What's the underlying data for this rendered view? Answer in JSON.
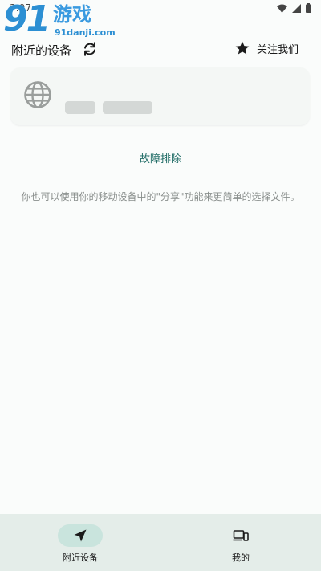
{
  "status_bar": {
    "time": "3:07"
  },
  "watermark": {
    "number": "91",
    "name": "游戏",
    "url": "91danji.com"
  },
  "header": {
    "title": "附近的设备",
    "follow_label": "关注我们"
  },
  "troubleshoot_label": "故障排除",
  "hint_text": "你也可以使用你的移动设备中的\"分享\"功能来更简单的选择文件。",
  "bottom_nav": [
    {
      "label": "附近设备",
      "icon": "send-icon",
      "selected": true
    },
    {
      "label": "我的",
      "icon": "devices-icon",
      "selected": false
    }
  ],
  "colors": {
    "accent": "#1d6a64",
    "nav_bg": "#e4ede9",
    "nav_pill": "#c9e4dd",
    "background": "#fafcfb"
  }
}
